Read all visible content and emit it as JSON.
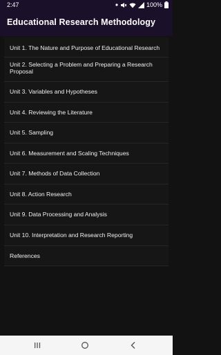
{
  "status": {
    "time": "2:47",
    "battery": "100%",
    "icons": [
      "dot-icon",
      "mute-icon",
      "wifi-icon",
      "signal-icon",
      "battery-icon"
    ]
  },
  "appbar": {
    "title": "Educational Research Methodology"
  },
  "list": {
    "items": [
      {
        "label": "Unit 1. The Nature and Purpose of Educational Research"
      },
      {
        "label": "Unit 2. Selecting a Problem and Preparing a Research Proposal"
      },
      {
        "label": "Unit 3. Variables and Hypotheses"
      },
      {
        "label": "Unit 4. Reviewing the Literature"
      },
      {
        "label": "Unit 5. Sampling"
      },
      {
        "label": "Unit 6. Measurement and Scaling Techniques"
      },
      {
        "label": "Unit 7. Methods of Data Collection"
      },
      {
        "label": "Unit 8. Action Research"
      },
      {
        "label": "Unit 9. Data Processing and Analysis"
      },
      {
        "label": "Unit 10. Interpretation and Research Reporting"
      },
      {
        "label": "References"
      }
    ]
  },
  "navbar": {
    "buttons": [
      "recents-icon",
      "home-icon",
      "back-icon"
    ]
  },
  "colors": {
    "appbar_bg": "#1b1029",
    "page_bg": "#121212",
    "list_bg": "#161616",
    "navbar_bg": "#f5f5f5"
  }
}
